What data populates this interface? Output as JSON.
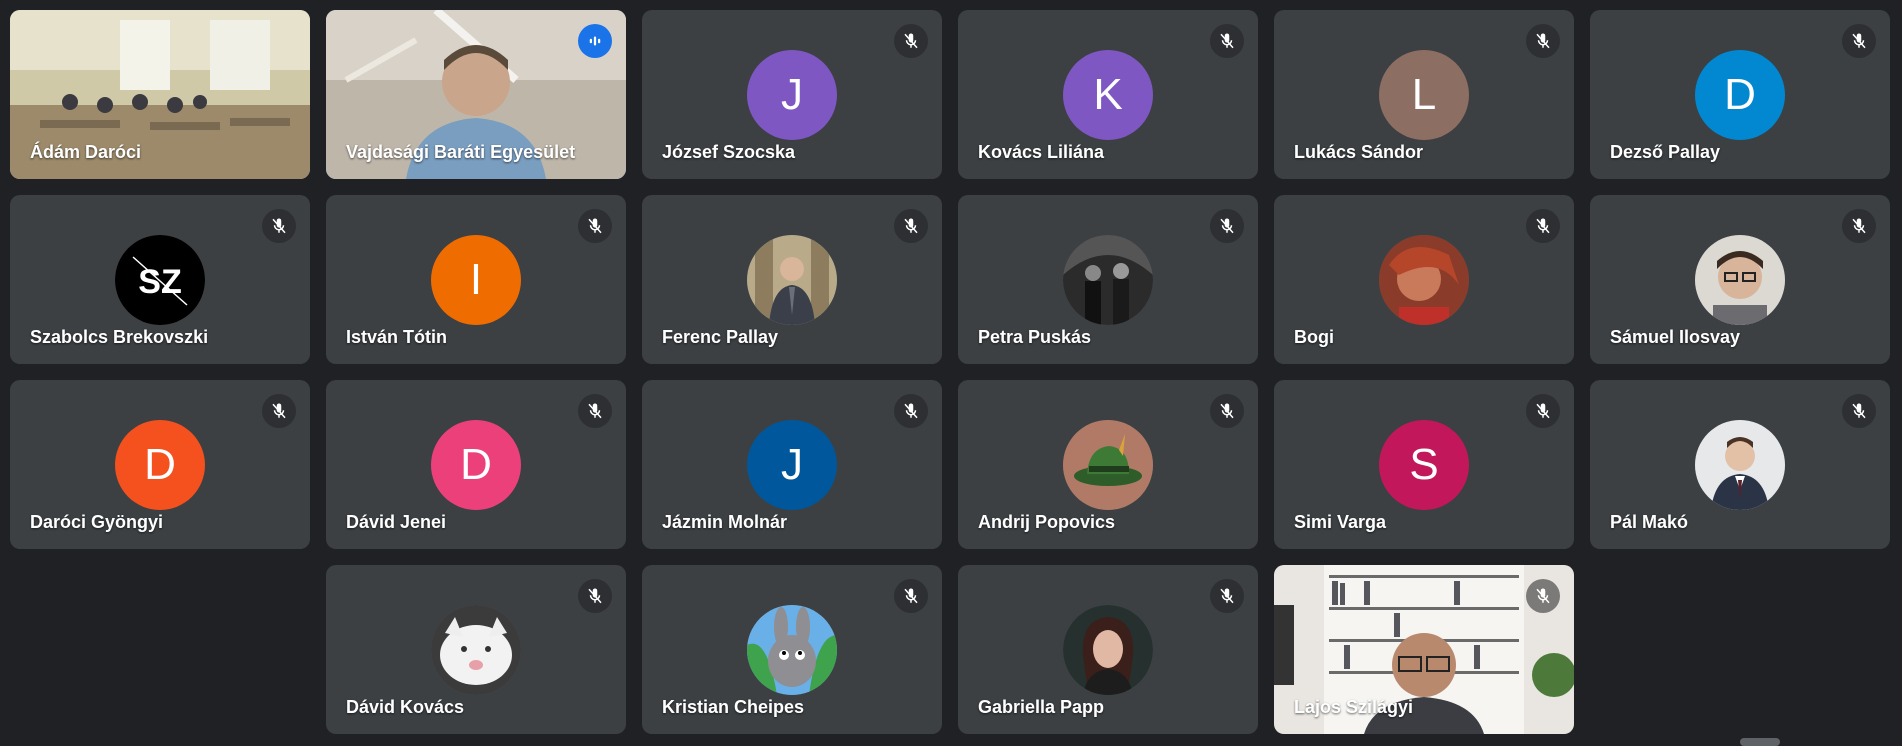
{
  "meeting": {
    "tiles": [
      {
        "name": "Ádám Daróci",
        "type": "video",
        "muted": false,
        "scene": "classroom"
      },
      {
        "name": "Vajdasági Baráti Egyesület",
        "type": "video",
        "muted": false,
        "speaking": true,
        "scene": "speaker"
      },
      {
        "name": "József Szocska",
        "type": "initial",
        "initial": "J",
        "color": "#7e57c2",
        "muted": true
      },
      {
        "name": "Kovács Liliána",
        "type": "initial",
        "initial": "K",
        "color": "#7e57c2",
        "muted": true
      },
      {
        "name": "Lukács Sándor",
        "type": "initial",
        "initial": "L",
        "color": "#8d6e63",
        "muted": true
      },
      {
        "name": "Dezső Pallay",
        "type": "initial",
        "initial": "D",
        "color": "#0288d1",
        "muted": true
      },
      {
        "name": "Szabolcs Brekovszki",
        "type": "photo",
        "photo": "sz-logo",
        "logo_text": "SZ",
        "muted": true
      },
      {
        "name": "István Tótin",
        "type": "initial",
        "initial": "I",
        "color": "#ef6c00",
        "muted": true
      },
      {
        "name": "Ferenc Pallay",
        "type": "photo",
        "photo": "man-suit-hall",
        "muted": true
      },
      {
        "name": "Petra Puskás",
        "type": "photo",
        "photo": "dark-figures",
        "muted": true
      },
      {
        "name": "Bogi",
        "type": "photo",
        "photo": "red-hair-girl",
        "muted": true
      },
      {
        "name": "Sámuel Ilosvay",
        "type": "photo",
        "photo": "boy-glasses",
        "muted": true
      },
      {
        "name": "Daróci Gyöngyi",
        "type": "initial",
        "initial": "D",
        "color": "#f4511e",
        "muted": true
      },
      {
        "name": "Dávid Jenei",
        "type": "initial",
        "initial": "D",
        "color": "#ec407a",
        "muted": true
      },
      {
        "name": "Jázmin Molnár",
        "type": "initial",
        "initial": "J",
        "color": "#01579b",
        "muted": true
      },
      {
        "name": "Andrij Popovics",
        "type": "photo",
        "photo": "green-hat",
        "muted": true
      },
      {
        "name": "Simi Varga",
        "type": "initial",
        "initial": "S",
        "color": "#c2185b",
        "muted": true
      },
      {
        "name": "Pál Makó",
        "type": "photo",
        "photo": "man-tie",
        "muted": true
      },
      {
        "name": "Dávid Kovács",
        "type": "photo",
        "photo": "white-cat",
        "muted": true
      },
      {
        "name": "Kristian Cheipes",
        "type": "photo",
        "photo": "cartoon-bunny",
        "muted": true
      },
      {
        "name": "Gabriella Papp",
        "type": "photo",
        "photo": "woman-portrait",
        "muted": true
      },
      {
        "name": "Lajos Szilágyi",
        "type": "video",
        "muted": true,
        "scene": "bookshelf"
      }
    ]
  },
  "colors": {
    "background": "#202124",
    "tile": "#3c4043",
    "speaking_outline": "#8ab4f8",
    "speaking_badge": "#1a73e8"
  }
}
